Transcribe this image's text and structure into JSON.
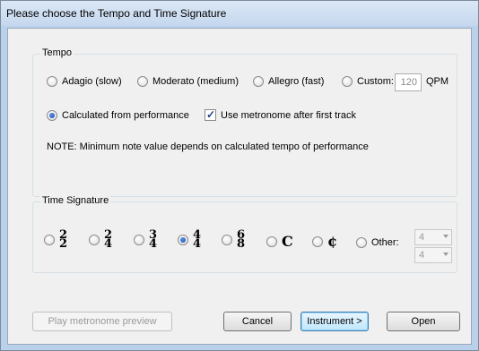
{
  "dialog": {
    "title": "Please choose the Tempo and Time Signature"
  },
  "tempo": {
    "label": "Tempo",
    "options": [
      {
        "label": "Adagio (slow)",
        "selected": false
      },
      {
        "label": "Moderato (medium)",
        "selected": false
      },
      {
        "label": "Allegro (fast)",
        "selected": false
      },
      {
        "label": "Custom:",
        "selected": false
      }
    ],
    "custom_value": "120",
    "custom_unit": "QPM",
    "calculated": {
      "label": "Calculated from performance",
      "selected": true
    },
    "metronome": {
      "label": "Use metronome after first track",
      "checked": true
    },
    "note": "NOTE: Minimum note value depends on calculated tempo of performance"
  },
  "time_signature": {
    "label": "Time Signature",
    "options": [
      {
        "top": "2",
        "bottom": "2",
        "selected": false
      },
      {
        "top": "2",
        "bottom": "4",
        "selected": false
      },
      {
        "top": "3",
        "bottom": "4",
        "selected": false
      },
      {
        "top": "4",
        "bottom": "4",
        "selected": true
      },
      {
        "top": "6",
        "bottom": "8",
        "selected": false
      },
      {
        "symbol": "C",
        "selected": false
      },
      {
        "symbol": "¢",
        "selected": false
      }
    ],
    "other_label": "Other:",
    "other_top": "4",
    "other_bottom": "4"
  },
  "buttons": {
    "preview": "Play metronome preview",
    "cancel": "Cancel",
    "instrument": "Instrument >",
    "open": "Open"
  }
}
